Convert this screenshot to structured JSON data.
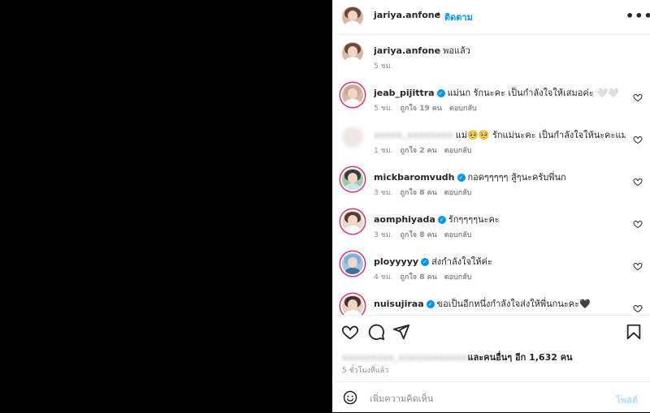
{
  "header": {
    "username": "jariya.anfone",
    "separator": "•",
    "follow_label": "ติดตาม",
    "more_icon": "more-horizontal-icon"
  },
  "caption": {
    "username": "jariya.anfone",
    "text": "พอแล้ว",
    "time": "5 ชม."
  },
  "comments": [
    {
      "username": "jeab_pijittra",
      "verified": true,
      "text": "แม่นก รักนะคะ เป็นกำลังใจให้เสมอค่ะ 🤍🤍",
      "time": "5 ชม.",
      "likes": "ถูกใจ 19 คน",
      "reply": "ตอบกลับ"
    },
    {
      "username": "xxxxx_xxxxxxxx",
      "blurred": true,
      "verified": false,
      "text": "แม่🥺🥺 รักแม่นะคะ เป็นกำลังใจให้นะคะแม่",
      "time": "1 ชม.",
      "likes": "ถูกใจ 2 คน",
      "reply": "ตอบกลับ"
    },
    {
      "username": "mickbaromvudh",
      "verified": true,
      "text": "กอดๆๆๆๆๆ สู้ๆนะครับพี่นก",
      "time": "3 ชม.",
      "likes": "ถูกใจ 8 คน",
      "reply": "ตอบกลับ"
    },
    {
      "username": "aomphiyada",
      "verified": true,
      "text": "รักๆๆๆๆนะคะ",
      "time": "3 ชม.",
      "likes": "ถูกใจ 8 คน",
      "reply": "ตอบกลับ"
    },
    {
      "username": "ployyyyy",
      "verified": true,
      "text": "ส่งกำลังใจให้ค่ะ",
      "time": "4 ชม.",
      "likes": "ถูกใจ 8 คน",
      "reply": "ตอบกลับ"
    },
    {
      "username": "nuisujiraa",
      "verified": true,
      "text": "ขอเป็นอีกหนึ่งกำลังใจส่งให้พี่นกนะคะ🖤",
      "time": "",
      "likes": "",
      "reply": ""
    }
  ],
  "actions": {
    "like_icon": "heart-icon",
    "comment_icon": "comment-icon",
    "share_icon": "send-icon",
    "save_icon": "bookmark-icon"
  },
  "likes_summary": {
    "blurred_name": "xxxxxxxxx_xxxxxxxxxxxx",
    "text": "และคนอื่นๆ อีก 1,632 คน"
  },
  "posted_time": "5 ชั่วโมงที่แล้ว",
  "add_comment": {
    "placeholder": "เพิ่มความคิดเห็น",
    "post_label": "โพสต์"
  },
  "colors": {
    "accent": "#0095f6",
    "post_disabled": "#b2dffc",
    "ring": "#e1306c"
  }
}
